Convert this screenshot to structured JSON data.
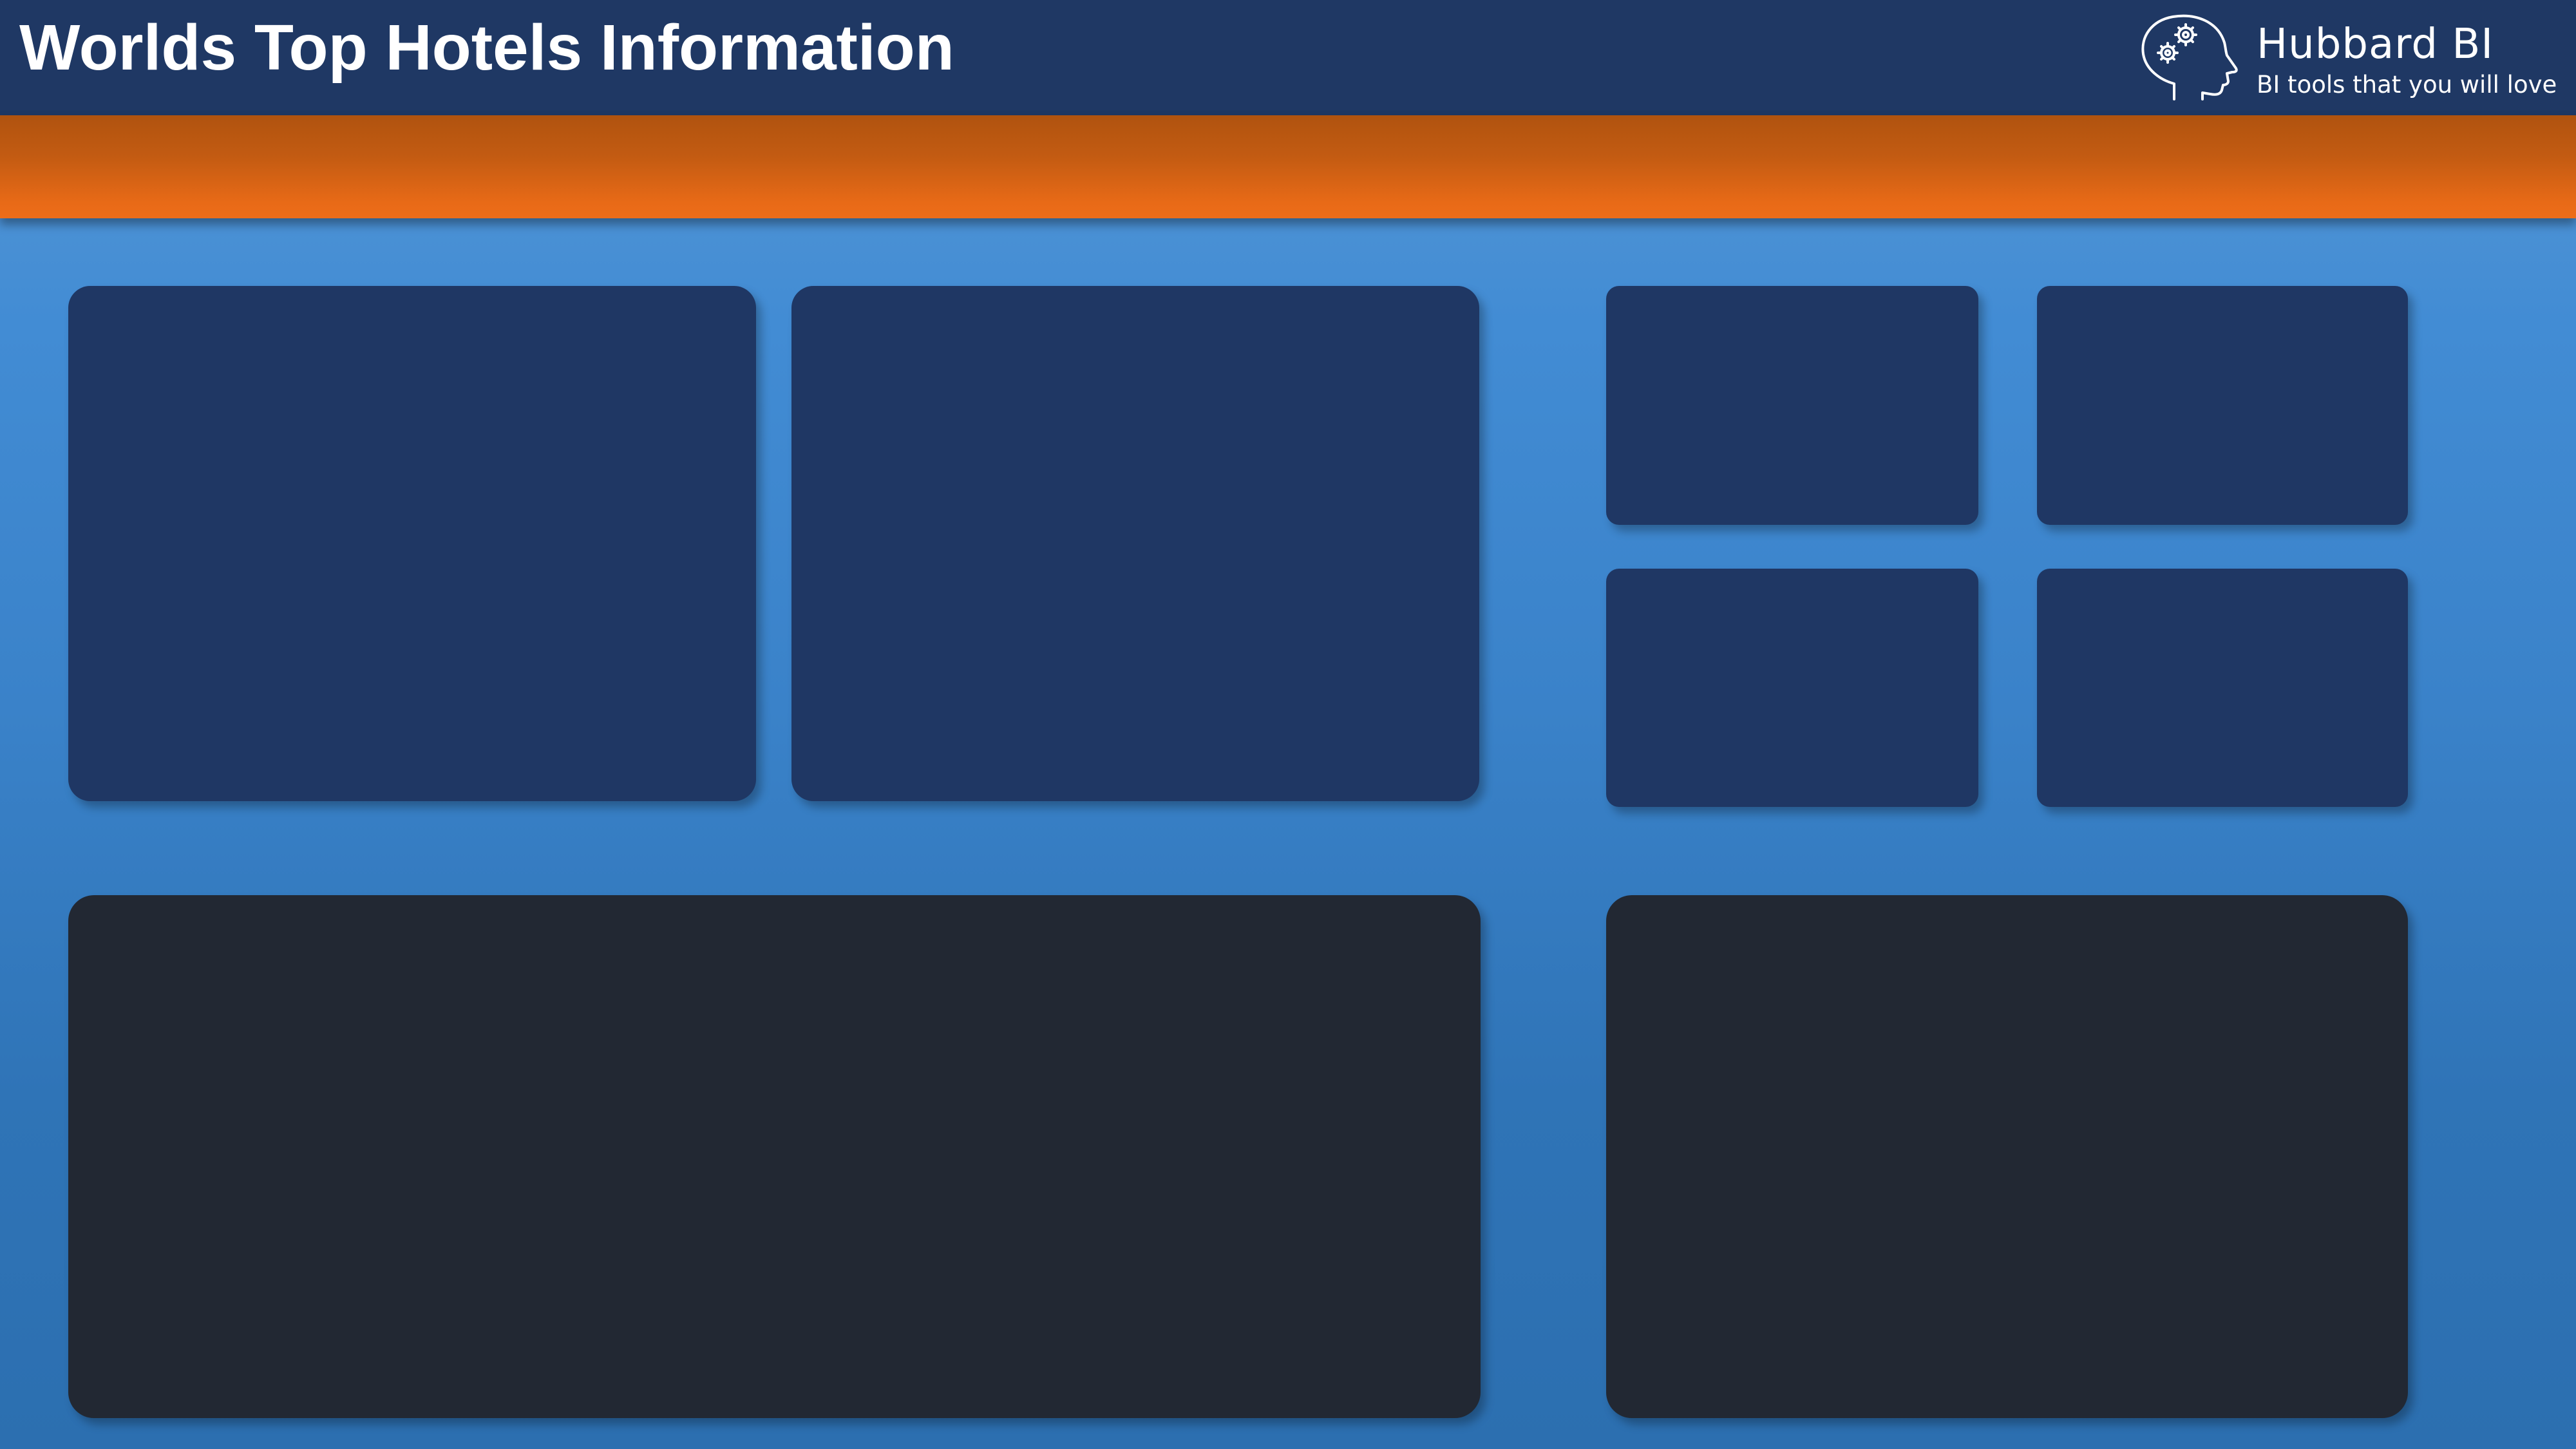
{
  "header": {
    "title": "Worlds Top Hotels Information",
    "brand": {
      "name": "Hubbard BI",
      "tagline": "BI tools that you will love",
      "logo_icon": "head-with-gears-icon"
    }
  },
  "colors": {
    "header_bg": "#1f3864",
    "accent_orange": "#e86a17",
    "page_bg": "#3a82c9",
    "card_navy": "#1f3764",
    "card_dark": "#222833"
  },
  "panels": [
    {
      "id": "panel-top-left",
      "style": "navy"
    },
    {
      "id": "panel-top-center",
      "style": "navy"
    },
    {
      "id": "kpi-card-1",
      "style": "navy"
    },
    {
      "id": "kpi-card-2",
      "style": "navy"
    },
    {
      "id": "kpi-card-3",
      "style": "navy"
    },
    {
      "id": "kpi-card-4",
      "style": "navy"
    },
    {
      "id": "panel-bottom-left",
      "style": "dark"
    },
    {
      "id": "panel-bottom-right",
      "style": "dark"
    }
  ]
}
